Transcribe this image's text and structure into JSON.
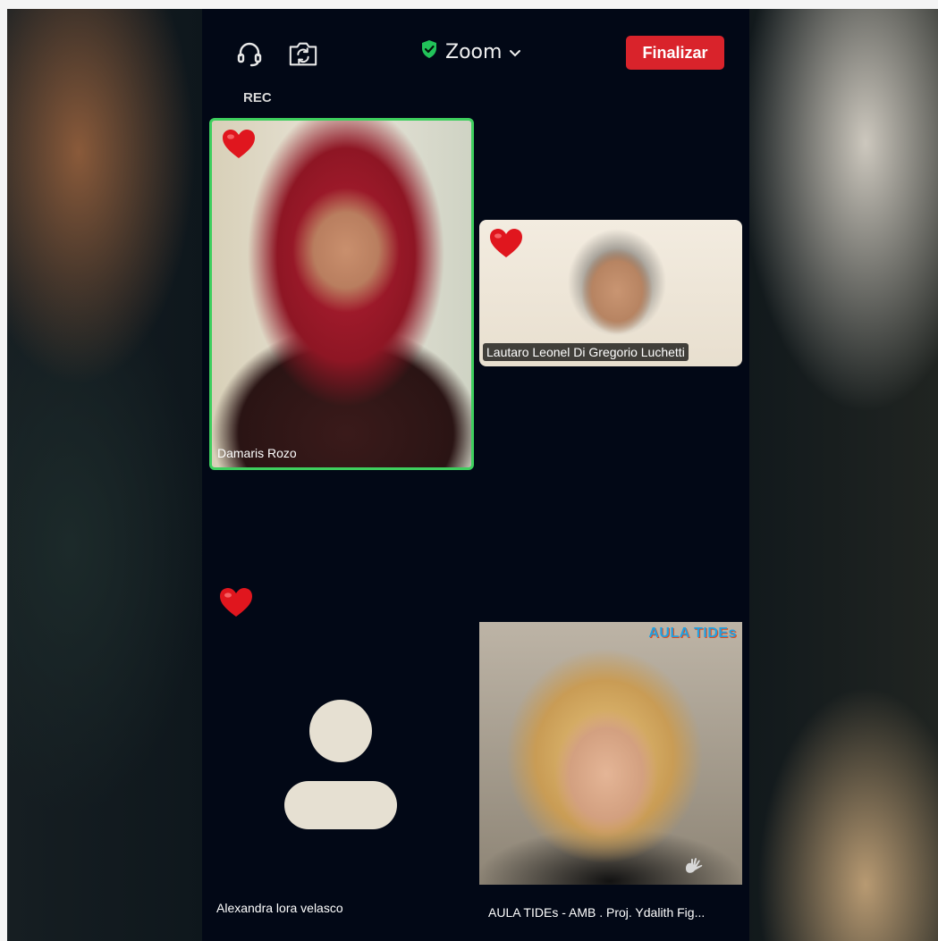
{
  "app": {
    "title": "Zoom",
    "end_button": "Finalizar",
    "recording_label": "REC",
    "colors": {
      "accent_green": "#3ecf5e",
      "end_red": "#d9232b",
      "background": "#020816"
    }
  },
  "participants": [
    {
      "name": "Damaris Rozo"
    },
    {
      "name": "Lautaro Leonel Di Gregorio Luchetti"
    },
    {
      "name": "Alexandra lora velasco"
    },
    {
      "name": "AULA TIDEs - AMB . Proj. Ydalith Fig..."
    }
  ],
  "logo": {
    "text": "AULA TIDEs"
  },
  "icons": [
    "headset-icon",
    "camera-flip-icon",
    "shield-check-icon",
    "chevron-down-icon",
    "heart-icon",
    "avatar-placeholder-icon",
    "raised-hand-icon"
  ]
}
